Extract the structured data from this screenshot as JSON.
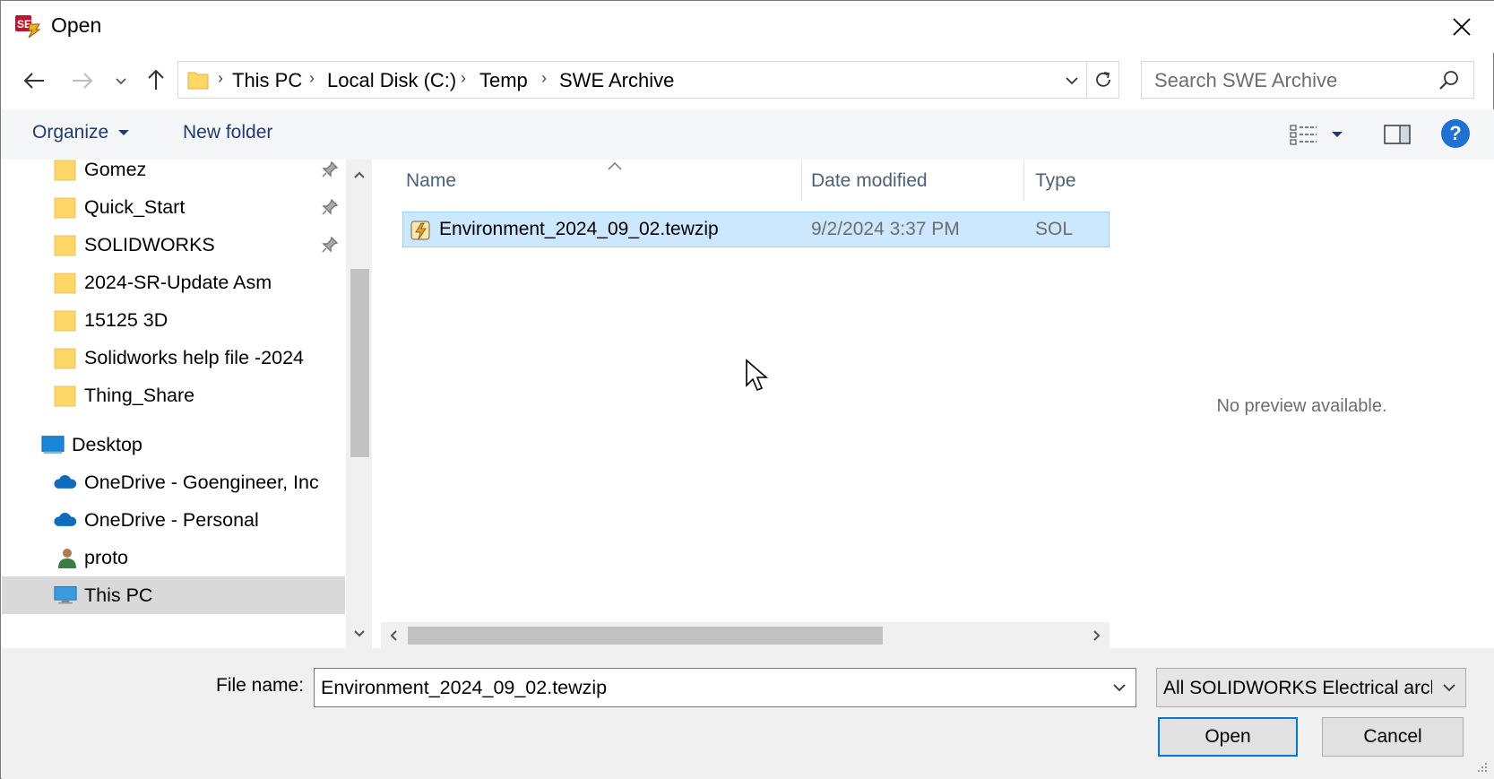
{
  "window": {
    "title": "Open"
  },
  "nav": {
    "back_icon": "arrow-left-icon",
    "forward_icon": "arrow-right-icon",
    "up_icon": "arrow-up-icon"
  },
  "address": {
    "crumbs": [
      "This PC",
      "Local Disk (C:)",
      "Temp",
      "SWE Archive"
    ]
  },
  "search": {
    "placeholder": "Search SWE Archive"
  },
  "toolbar": {
    "organize_label": "Organize",
    "new_folder_label": "New folder",
    "help_label": "?"
  },
  "sidebar": {
    "items": [
      {
        "label": "Gomez",
        "icon": "folder-icon",
        "pinned": true
      },
      {
        "label": "Quick_Start",
        "icon": "folder-icon",
        "pinned": true
      },
      {
        "label": "SOLIDWORKS",
        "icon": "folder-icon",
        "pinned": true
      },
      {
        "label": "2024-SR-Update Asm",
        "icon": "folder-icon",
        "pinned": false
      },
      {
        "label": "15125 3D",
        "icon": "folder-icon",
        "pinned": false
      },
      {
        "label": "Solidworks help file -2024",
        "icon": "folder-icon",
        "pinned": false
      },
      {
        "label": "Thing_Share",
        "icon": "folder-icon",
        "pinned": false
      },
      {
        "label": "Desktop",
        "icon": "desktop-icon",
        "pinned": false
      },
      {
        "label": "OneDrive - Goengineer, Inc",
        "icon": "cloud-icon",
        "pinned": false
      },
      {
        "label": "OneDrive - Personal",
        "icon": "cloud-icon",
        "pinned": false
      },
      {
        "label": "proto",
        "icon": "user-icon",
        "pinned": false
      },
      {
        "label": "This PC",
        "icon": "computer-icon",
        "pinned": false,
        "selected": true
      }
    ]
  },
  "file_list": {
    "columns": [
      "Name",
      "Date modified",
      "Type"
    ],
    "rows": [
      {
        "name": "Environment_2024_09_02.tewzip",
        "date": "9/2/2024 3:37 PM",
        "type": "SOL",
        "selected": true
      }
    ]
  },
  "preview": {
    "text": "No preview available."
  },
  "bottom": {
    "file_name_label": "File name:",
    "file_name_value": "Environment_2024_09_02.tewzip",
    "file_type_value": "All SOLIDWORKS Electrical arch",
    "open_label": "Open",
    "cancel_label": "Cancel"
  },
  "colors": {
    "accent": "#0078d7",
    "selection": "#cce8ff",
    "folder": "#ffd766",
    "link_text": "#1f3b73"
  }
}
